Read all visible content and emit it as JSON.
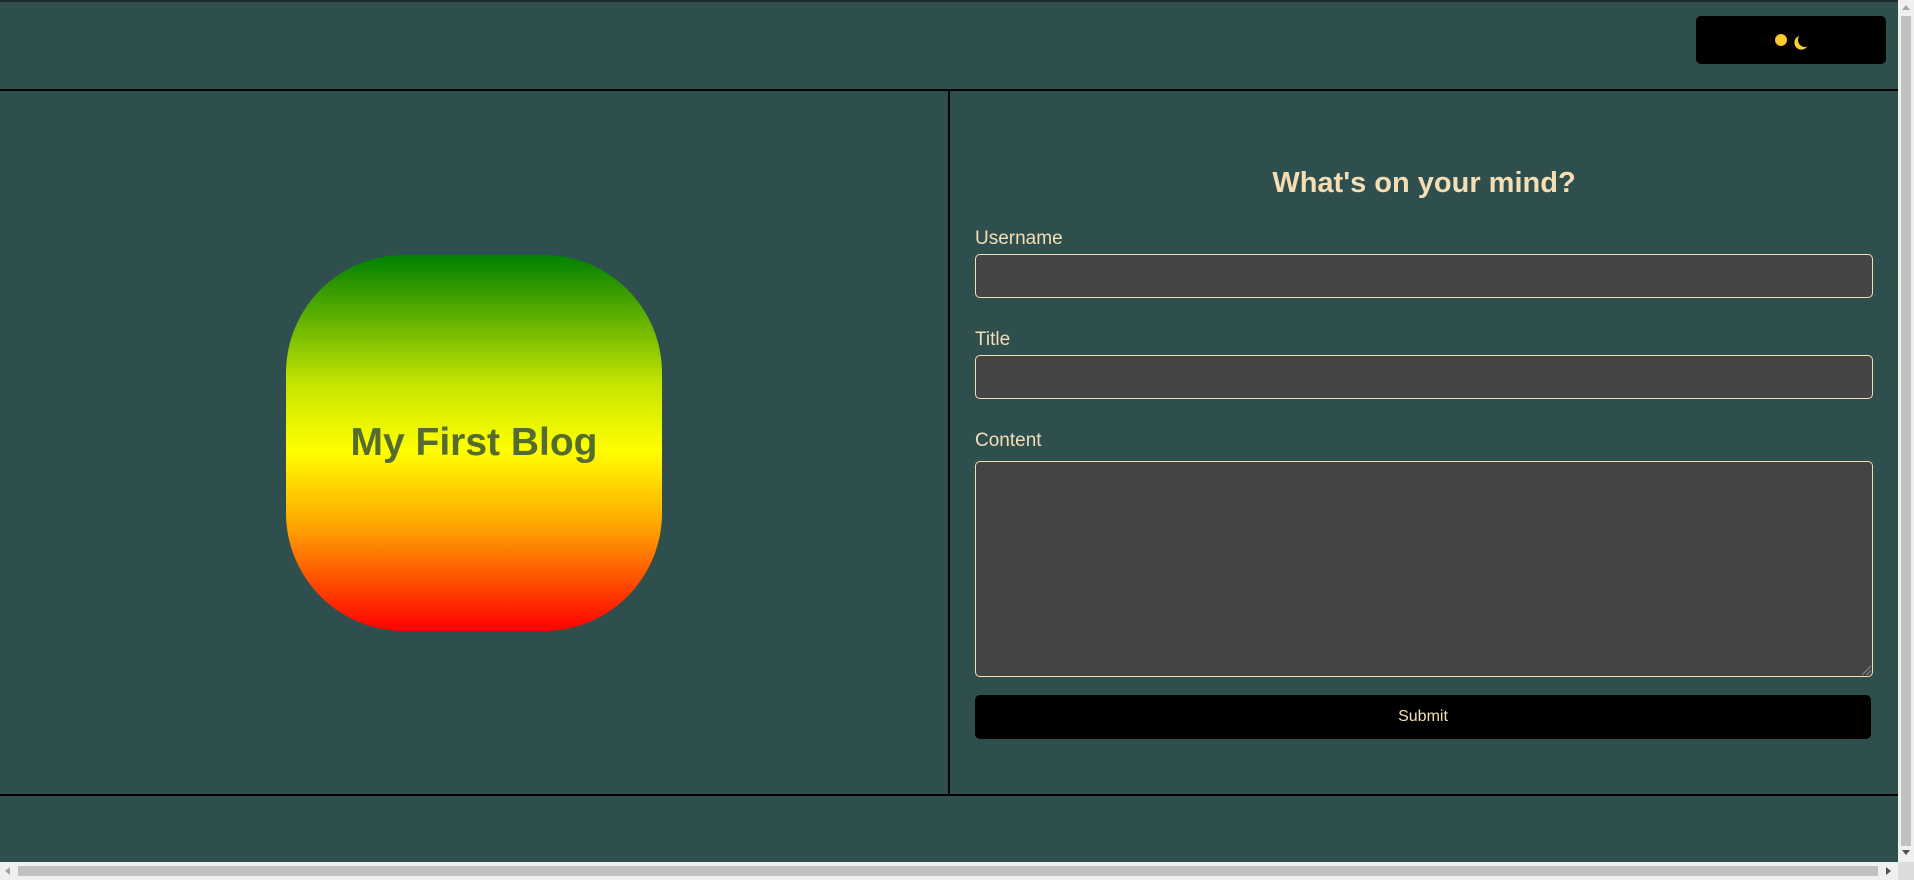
{
  "header": {
    "theme_toggle_icons": [
      "sun-icon",
      "moon-icon"
    ]
  },
  "hero": {
    "title": "My First Blog",
    "gradient_colors": [
      "#008000",
      "#ffff00",
      "#ffa500",
      "#ff0000"
    ]
  },
  "form": {
    "heading": "What's on your mind?",
    "username_label": "Username",
    "username_value": "",
    "title_label": "Title",
    "title_value": "",
    "content_label": "Content",
    "content_value": "",
    "submit_label": "Submit"
  },
  "colors": {
    "background": "#2f4f4f",
    "accent_text": "#f5deb3",
    "input_background": "#444444",
    "button_background": "#000000",
    "hero_title": "#556b2f"
  }
}
